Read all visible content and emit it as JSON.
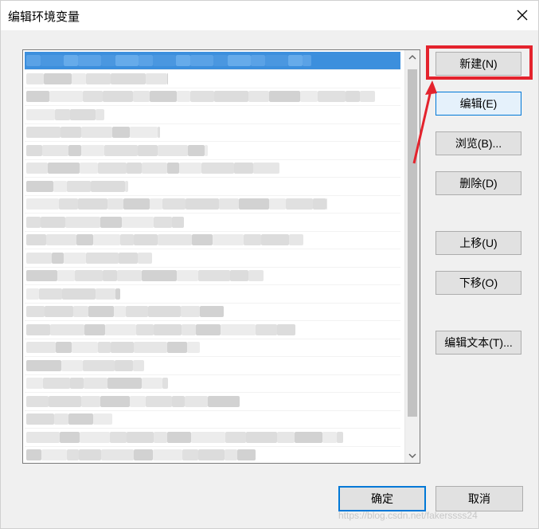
{
  "window": {
    "title": "编辑环境变量",
    "close_icon": "close-icon"
  },
  "list": {
    "rows": 23,
    "selected_row": 0,
    "contents_blurred": true
  },
  "buttons": {
    "new": "新建(N)",
    "edit": "编辑(E)",
    "browse": "浏览(B)...",
    "delete": "删除(D)",
    "move_up": "上移(U)",
    "move_down": "下移(O)",
    "edit_text": "编辑文本(T)...",
    "ok": "确定",
    "cancel": "取消"
  },
  "annotation": {
    "color": "#e4232d",
    "target": "新建(N)"
  },
  "watermark": "https://blog.csdn.net/fakerssss24"
}
